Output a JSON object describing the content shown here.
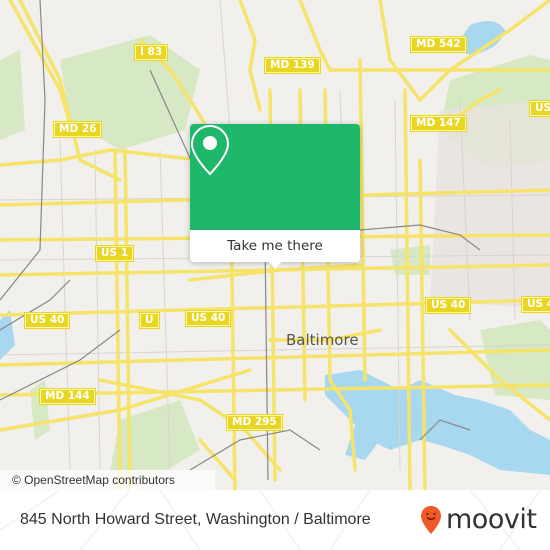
{
  "map": {
    "city_label": "Baltimore",
    "attribution": "© OpenStreetMap contributors",
    "colors": {
      "land": "#f2f0ec",
      "park": "#d6e8c4",
      "water": "#a8d8f0",
      "road": "#f5e36a",
      "shield": "#e9d623"
    },
    "route_shields": [
      {
        "id": "i83",
        "label": "I 83"
      },
      {
        "id": "md542",
        "label": "MD 542"
      },
      {
        "id": "md139",
        "label": "MD 139"
      },
      {
        "id": "us-ne",
        "label": "US"
      },
      {
        "id": "md147",
        "label": "MD 147"
      },
      {
        "id": "md26",
        "label": "MD 26"
      },
      {
        "id": "us1",
        "label": "US 1"
      },
      {
        "id": "us40-w",
        "label": "US 40"
      },
      {
        "id": "us40-trunc",
        "label": "U"
      },
      {
        "id": "us40-c",
        "label": "US 40"
      },
      {
        "id": "us40-e",
        "label": "US 40"
      },
      {
        "id": "us40-far",
        "label": "US 4"
      },
      {
        "id": "md144",
        "label": "MD 144"
      },
      {
        "id": "md295",
        "label": "MD 295"
      }
    ]
  },
  "popup": {
    "icon": "map-pin-icon",
    "button_label": "Take me there",
    "accent": "#1fb76a"
  },
  "footer": {
    "address": "845 North Howard Street, Washington / Baltimore",
    "brand": "moovit",
    "brand_color": "#f05a28"
  }
}
